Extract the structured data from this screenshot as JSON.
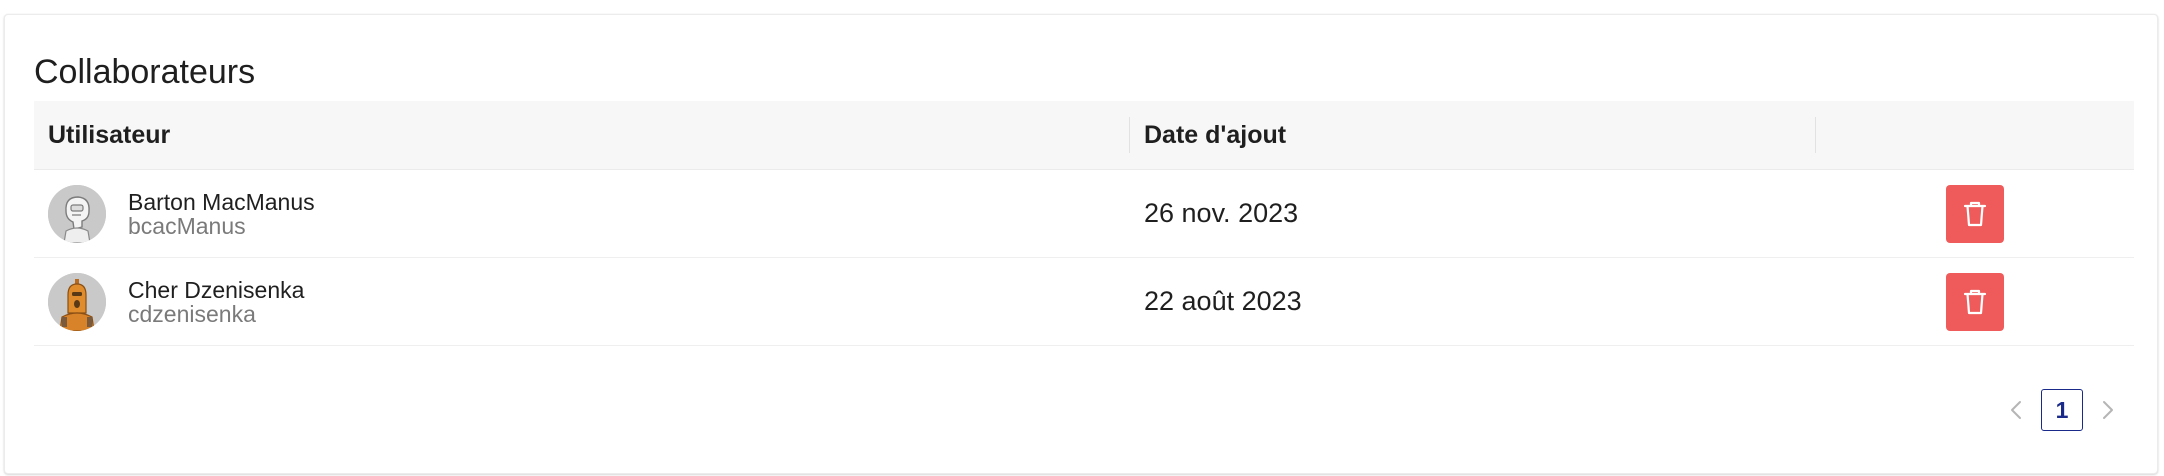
{
  "card": {
    "title": "Collaborateurs"
  },
  "table": {
    "headers": {
      "user": "Utilisateur",
      "date": "Date d'ajout",
      "actions": ""
    },
    "rows": [
      {
        "name": "Barton MacManus",
        "login": "bcacManus",
        "date": "26 nov. 2023",
        "avatar_icon": "robot-white-avatar-icon",
        "delete_icon": "trash-icon"
      },
      {
        "name": "Cher Dzenisenka",
        "login": "cdzenisenka",
        "date": "22 août 2023",
        "avatar_icon": "robot-orange-avatar-icon",
        "delete_icon": "trash-icon"
      }
    ]
  },
  "pagination": {
    "current_page": "1",
    "prev_icon": "chevron-left-icon",
    "next_icon": "chevron-right-icon"
  },
  "colors": {
    "delete_button": "#ef5b5b",
    "pager_active": "#1a2a8a",
    "header_background": "#f7f7f7"
  }
}
